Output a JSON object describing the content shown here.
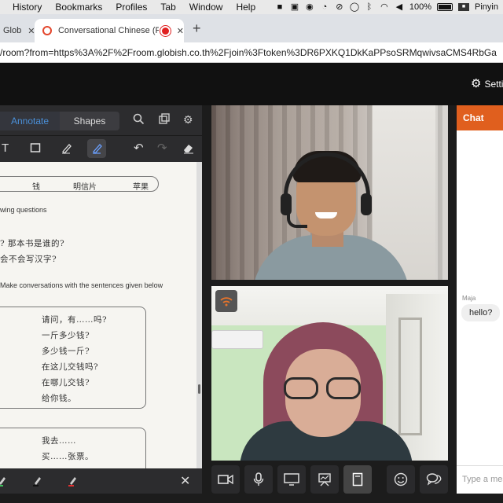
{
  "menubar": {
    "items": [
      "History",
      "Bookmarks",
      "Profiles",
      "Tab",
      "Window",
      "Help"
    ],
    "battery": "100%",
    "input_method": "Pinyin"
  },
  "browser": {
    "tab_inactive_title": "Glob",
    "tab_active_title": "Conversational Chinese (Fu",
    "url": "/room?from=https%3A%2F%2Froom.globish.co.th%2Fjoin%3Ftoken%3DR6PXKQ1DkKaPPsoSRMqwivsaCMS4RbGa"
  },
  "header": {
    "settings_label": "Setti"
  },
  "whiteboard": {
    "tabs": [
      "Annotate",
      "Shapes"
    ],
    "text_tool": "T",
    "doc": {
      "words": [
        "钱",
        "明信片",
        "苹果"
      ],
      "instruction1": "wing questions",
      "line1": "? 那本书是谁的?",
      "line2": "会不会写汉字?",
      "instruction2": "Make conversations with the sentences given below",
      "dialog": [
        "请问，有……吗?",
        "一斤多少钱?",
        "多少钱一斤?",
        "在这儿交钱吗?",
        "在哪儿交钱?",
        "给你钱。"
      ],
      "dialog2": [
        "我去……",
        "买……张票。"
      ]
    }
  },
  "chat": {
    "title": "Chat",
    "sender": "Maja",
    "message": "hello?",
    "input_placeholder": "Type a mes"
  },
  "colors": {
    "chat_header": "#e05f1e",
    "annotate_active": "#4a90d9",
    "rec_dot": "#e02020"
  }
}
